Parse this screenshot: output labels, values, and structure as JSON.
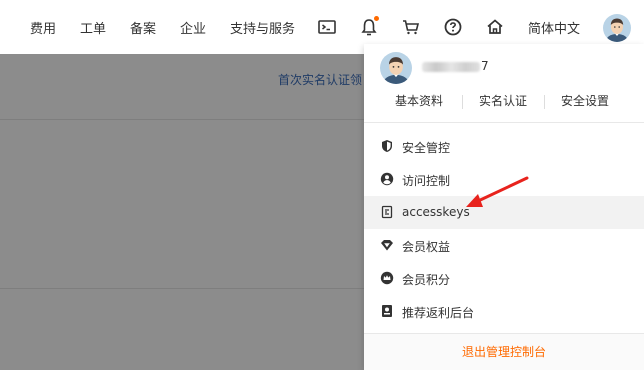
{
  "nav": {
    "items": [
      "费用",
      "工单",
      "备案",
      "企业",
      "支持与服务"
    ],
    "language": "简体中文",
    "icons": [
      "terminal-icon",
      "bell-icon",
      "cart-icon",
      "help-icon",
      "home-icon"
    ]
  },
  "background": {
    "link_text": "首次实名认证领"
  },
  "account_panel": {
    "username_suffix": "7",
    "tabs": [
      "基本资料",
      "实名认证",
      "安全设置"
    ],
    "menu": [
      {
        "label": "安全管控",
        "icon": "shield-icon"
      },
      {
        "label": "访问控制",
        "icon": "user-circle-icon"
      },
      {
        "label": "accesskeys",
        "icon": "key-card-icon"
      },
      {
        "label": "会员权益",
        "icon": "diamond-icon"
      },
      {
        "label": "会员积分",
        "icon": "crown-icon"
      },
      {
        "label": "推荐返利后台",
        "icon": "referral-icon"
      }
    ],
    "logout_label": "退出管理控制台"
  },
  "colors": {
    "accent": "#ff6a00",
    "overlay": "#8c8c8c",
    "annotation_arrow": "#e8231d"
  }
}
